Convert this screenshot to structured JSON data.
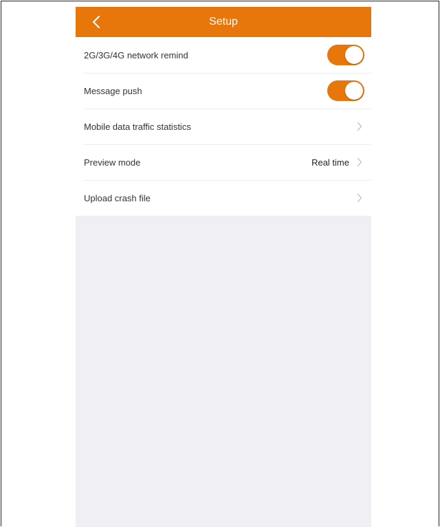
{
  "header": {
    "title": "Setup",
    "back_icon": "chevron-left-icon"
  },
  "settings": [
    {
      "label": "2G/3G/4G network remind",
      "control": "toggle",
      "on": true
    },
    {
      "label": "Message push",
      "control": "toggle",
      "on": true
    },
    {
      "label": "Mobile data traffic statistics",
      "control": "disclosure"
    },
    {
      "label": "Preview mode",
      "control": "disclosure",
      "value": "Real time"
    },
    {
      "label": "Upload crash file",
      "control": "disclosure"
    }
  ],
  "colors": {
    "accent": "#e8770b",
    "background": "#f0f0f4",
    "list_background": "#ffffff"
  }
}
